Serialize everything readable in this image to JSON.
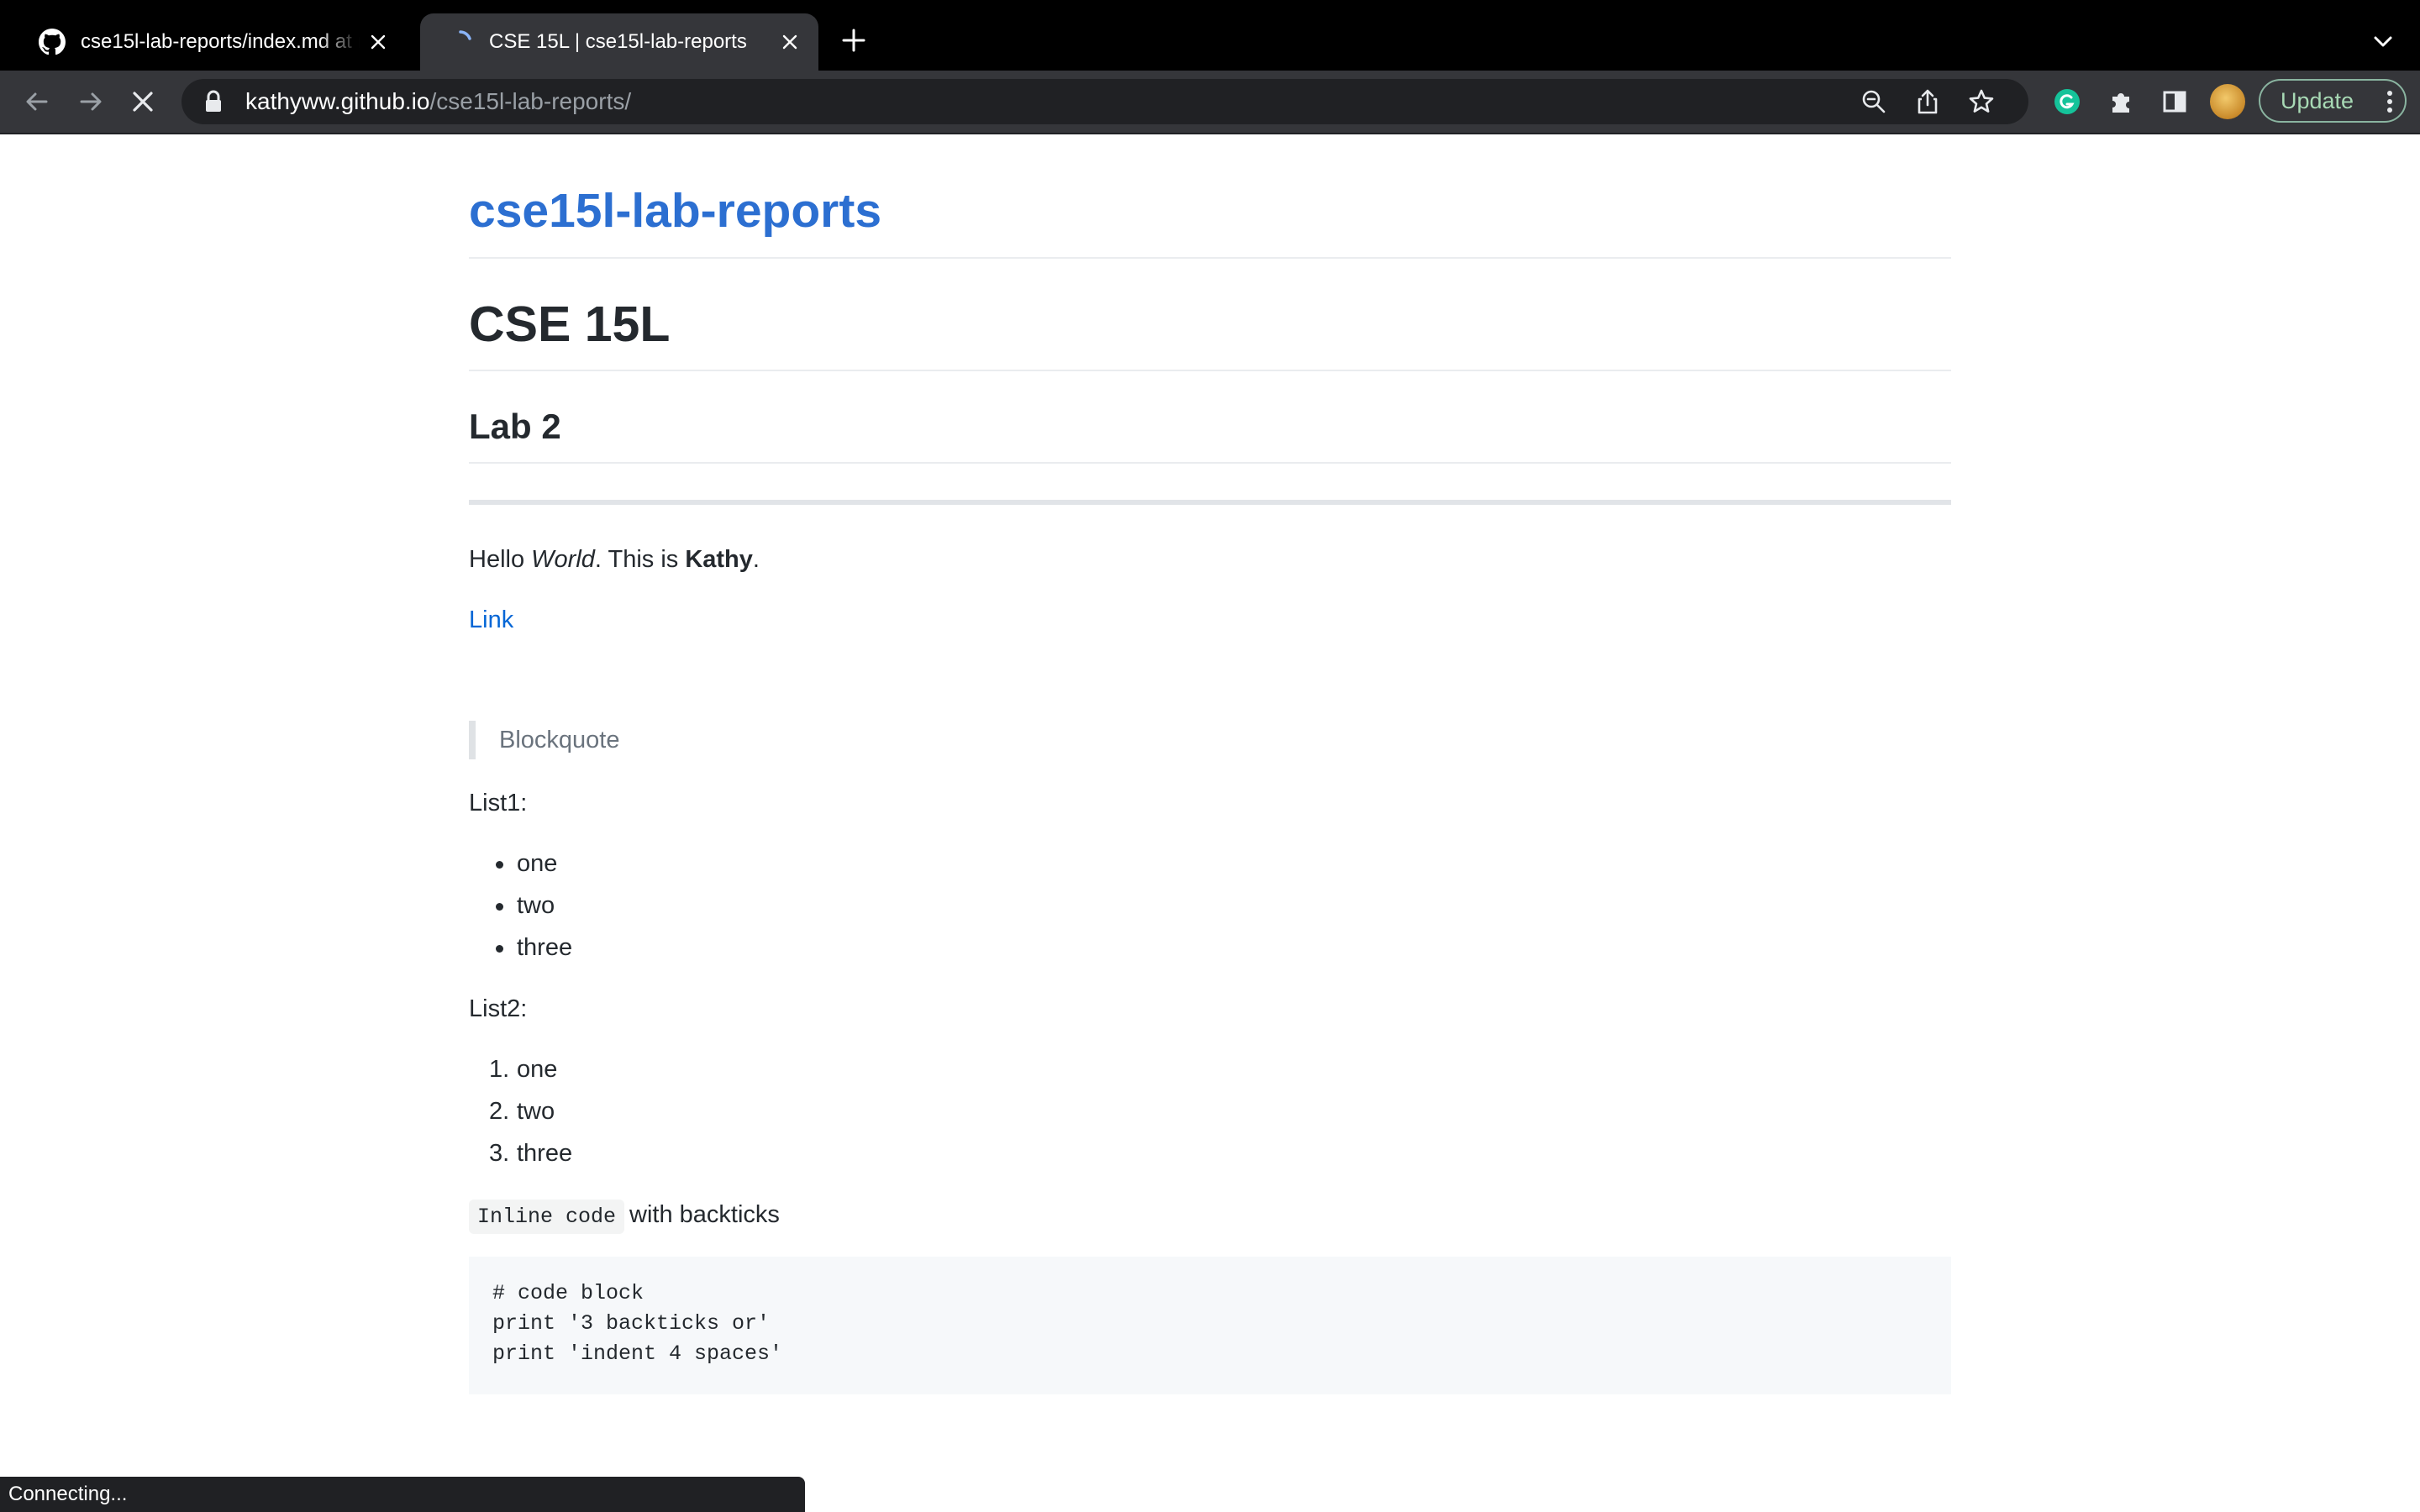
{
  "browser": {
    "tabs": [
      {
        "title": "cse15l-lab-reports/index.md at main",
        "favicon": "github-icon",
        "active": false
      },
      {
        "title": "CSE 15L | cse15l-lab-reports",
        "favicon": "loading-spinner-icon",
        "active": true
      }
    ],
    "url": {
      "host": "kathyww.github.io",
      "path": "/cse15l-lab-reports/"
    },
    "update_label": "Update",
    "status_text": "Connecting...",
    "colors": {
      "tab_bar": "#000000",
      "toolbar": "#35363a",
      "omnibox": "#202124",
      "update_green": "#a8dab5",
      "grammarly_green": "#15c39a"
    }
  },
  "page": {
    "site_title": "cse15l-lab-reports",
    "h1": "CSE 15L",
    "h2": "Lab 2",
    "intro": {
      "prefix": "Hello ",
      "italic": "World",
      "middle": ". This is ",
      "bold": "Kathy",
      "suffix": "."
    },
    "link_text": "Link",
    "blockquote": "Blockquote",
    "list1_label": "List1:",
    "list1": [
      "one",
      "two",
      "three"
    ],
    "list2_label": "List2:",
    "list2": [
      {
        "marker": "1.",
        "text": "one"
      },
      {
        "marker": "2.",
        "text": "two"
      },
      {
        "marker": "3.",
        "text": "three"
      }
    ],
    "inline_code": "Inline code",
    "inline_code_suffix": "with backticks",
    "code_block": [
      "# code block",
      "print '3 backticks or'",
      "print 'indent 4 spaces'"
    ],
    "colors": {
      "title_link": "#2c6fd1",
      "link": "#0366d6",
      "text": "#24292e",
      "code_bg": "#f6f8fa"
    }
  }
}
